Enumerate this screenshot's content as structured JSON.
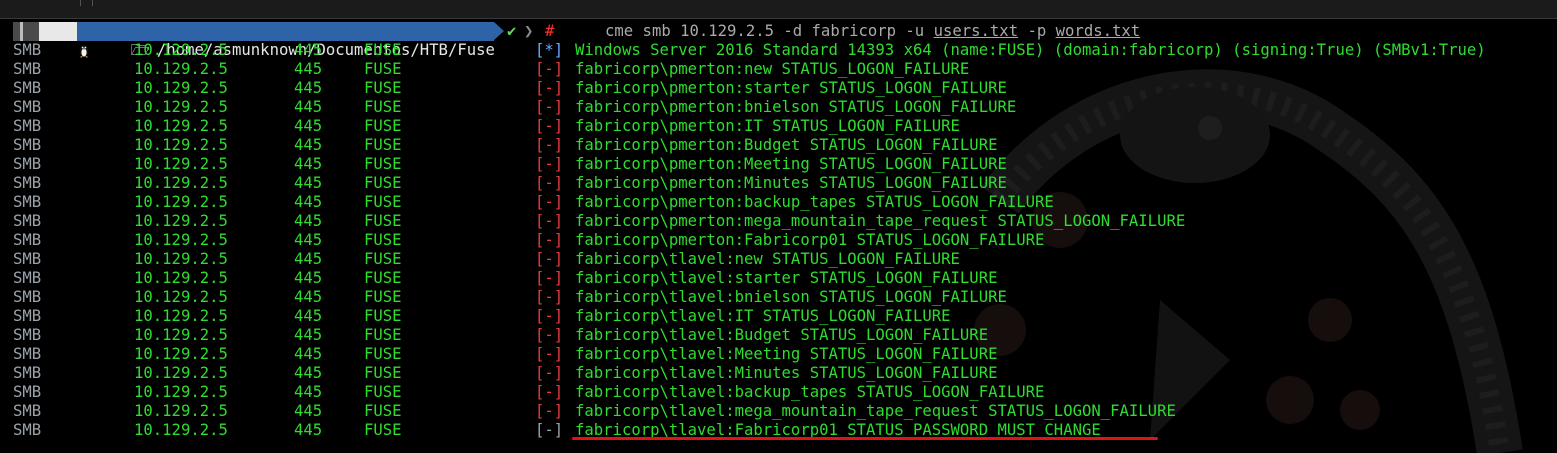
{
  "prompt": {
    "os_icon": "linux-penguin-icon",
    "folder_icon": "folder-icon",
    "path": "/home/asmunknown/Documentos/HTB/Fuse",
    "status_check": "✔",
    "status_sep": "❯",
    "status_hash": "#",
    "command_parts": [
      "cme smb 10.129.2.5 -d fabricorp -u ",
      "users.txt",
      " -p ",
      "words.txt"
    ]
  },
  "colors": {
    "background": "#000000",
    "green_text": "#2fdc2f",
    "red_marker": "#e83a3a",
    "path_segment": "#2f63a8",
    "highlight_underline": "#e01414"
  },
  "rows": [
    {
      "proto": "SMB",
      "ip": "10.129.2.5",
      "port": "445",
      "host": "FUSE",
      "mark": "[*]",
      "type": "info",
      "msg": "Windows Server 2016 Standard 14393 x64 (name:FUSE) (domain:fabricorp) (signing:True) (SMBv1:True)"
    },
    {
      "proto": "SMB",
      "ip": "10.129.2.5",
      "port": "445",
      "host": "FUSE",
      "mark": "[-]",
      "type": "fail",
      "msg": "fabricorp\\pmerton:new STATUS_LOGON_FAILURE"
    },
    {
      "proto": "SMB",
      "ip": "10.129.2.5",
      "port": "445",
      "host": "FUSE",
      "mark": "[-]",
      "type": "fail",
      "msg": "fabricorp\\pmerton:starter STATUS_LOGON_FAILURE"
    },
    {
      "proto": "SMB",
      "ip": "10.129.2.5",
      "port": "445",
      "host": "FUSE",
      "mark": "[-]",
      "type": "fail",
      "msg": "fabricorp\\pmerton:bnielson STATUS_LOGON_FAILURE"
    },
    {
      "proto": "SMB",
      "ip": "10.129.2.5",
      "port": "445",
      "host": "FUSE",
      "mark": "[-]",
      "type": "fail",
      "msg": "fabricorp\\pmerton:IT STATUS_LOGON_FAILURE"
    },
    {
      "proto": "SMB",
      "ip": "10.129.2.5",
      "port": "445",
      "host": "FUSE",
      "mark": "[-]",
      "type": "fail",
      "msg": "fabricorp\\pmerton:Budget STATUS_LOGON_FAILURE"
    },
    {
      "proto": "SMB",
      "ip": "10.129.2.5",
      "port": "445",
      "host": "FUSE",
      "mark": "[-]",
      "type": "fail",
      "msg": "fabricorp\\pmerton:Meeting STATUS_LOGON_FAILURE"
    },
    {
      "proto": "SMB",
      "ip": "10.129.2.5",
      "port": "445",
      "host": "FUSE",
      "mark": "[-]",
      "type": "fail",
      "msg": "fabricorp\\pmerton:Minutes STATUS_LOGON_FAILURE"
    },
    {
      "proto": "SMB",
      "ip": "10.129.2.5",
      "port": "445",
      "host": "FUSE",
      "mark": "[-]",
      "type": "fail",
      "msg": "fabricorp\\pmerton:backup_tapes STATUS_LOGON_FAILURE"
    },
    {
      "proto": "SMB",
      "ip": "10.129.2.5",
      "port": "445",
      "host": "FUSE",
      "mark": "[-]",
      "type": "fail",
      "msg": "fabricorp\\pmerton:mega_mountain_tape_request STATUS_LOGON_FAILURE"
    },
    {
      "proto": "SMB",
      "ip": "10.129.2.5",
      "port": "445",
      "host": "FUSE",
      "mark": "[-]",
      "type": "fail",
      "msg": "fabricorp\\pmerton:Fabricorp01 STATUS_LOGON_FAILURE"
    },
    {
      "proto": "SMB",
      "ip": "10.129.2.5",
      "port": "445",
      "host": "FUSE",
      "mark": "[-]",
      "type": "fail",
      "msg": "fabricorp\\tlavel:new STATUS_LOGON_FAILURE"
    },
    {
      "proto": "SMB",
      "ip": "10.129.2.5",
      "port": "445",
      "host": "FUSE",
      "mark": "[-]",
      "type": "fail",
      "msg": "fabricorp\\tlavel:starter STATUS_LOGON_FAILURE"
    },
    {
      "proto": "SMB",
      "ip": "10.129.2.5",
      "port": "445",
      "host": "FUSE",
      "mark": "[-]",
      "type": "fail",
      "msg": "fabricorp\\tlavel:bnielson STATUS_LOGON_FAILURE"
    },
    {
      "proto": "SMB",
      "ip": "10.129.2.5",
      "port": "445",
      "host": "FUSE",
      "mark": "[-]",
      "type": "fail",
      "msg": "fabricorp\\tlavel:IT STATUS_LOGON_FAILURE"
    },
    {
      "proto": "SMB",
      "ip": "10.129.2.5",
      "port": "445",
      "host": "FUSE",
      "mark": "[-]",
      "type": "fail",
      "msg": "fabricorp\\tlavel:Budget STATUS_LOGON_FAILURE"
    },
    {
      "proto": "SMB",
      "ip": "10.129.2.5",
      "port": "445",
      "host": "FUSE",
      "mark": "[-]",
      "type": "fail",
      "msg": "fabricorp\\tlavel:Meeting STATUS_LOGON_FAILURE"
    },
    {
      "proto": "SMB",
      "ip": "10.129.2.5",
      "port": "445",
      "host": "FUSE",
      "mark": "[-]",
      "type": "fail",
      "msg": "fabricorp\\tlavel:Minutes STATUS_LOGON_FAILURE"
    },
    {
      "proto": "SMB",
      "ip": "10.129.2.5",
      "port": "445",
      "host": "FUSE",
      "mark": "[-]",
      "type": "fail",
      "msg": "fabricorp\\tlavel:backup_tapes STATUS_LOGON_FAILURE"
    },
    {
      "proto": "SMB",
      "ip": "10.129.2.5",
      "port": "445",
      "host": "FUSE",
      "mark": "[-]",
      "type": "fail",
      "msg": "fabricorp\\tlavel:mega_mountain_tape_request STATUS_LOGON_FAILURE"
    },
    {
      "proto": "SMB",
      "ip": "10.129.2.5",
      "port": "445",
      "host": "FUSE",
      "mark": "[-]",
      "type": "ok",
      "msg": "fabricorp\\tlavel:Fabricorp01 STATUS_PASSWORD_MUST_CHANGE"
    }
  ]
}
